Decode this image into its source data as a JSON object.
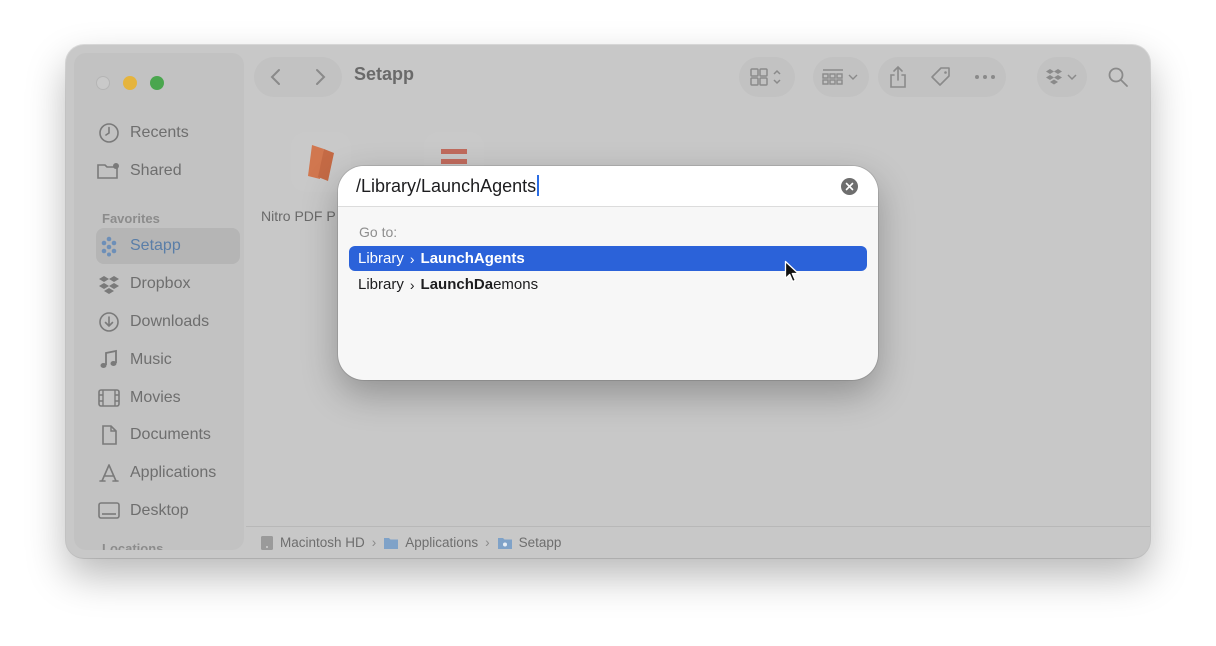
{
  "window": {
    "title": "Setapp"
  },
  "sidebar": {
    "items_top": [
      {
        "label": "Recents",
        "icon": "clock-icon"
      },
      {
        "label": "Shared",
        "icon": "shared-folder-icon"
      }
    ],
    "favorites_heading": "Favorites",
    "favorites": [
      {
        "label": "Setapp",
        "icon": "setapp-icon",
        "selected": true
      },
      {
        "label": "Dropbox",
        "icon": "dropbox-icon"
      },
      {
        "label": "Downloads",
        "icon": "download-icon"
      },
      {
        "label": "Music",
        "icon": "music-icon"
      },
      {
        "label": "Movies",
        "icon": "film-icon"
      },
      {
        "label": "Documents",
        "icon": "document-icon"
      },
      {
        "label": "Applications",
        "icon": "applications-icon"
      },
      {
        "label": "Desktop",
        "icon": "desktop-icon"
      }
    ],
    "locations_heading": "Locations"
  },
  "content": {
    "file_label": "Nitro PDF P"
  },
  "pathbar": {
    "segments": [
      "Macintosh HD",
      "Applications",
      "Setapp"
    ],
    "separator": "›"
  },
  "goto_dialog": {
    "input_value": "/Library/LaunchAgents",
    "goto_label": "Go to:",
    "results": [
      {
        "parent": "Library",
        "chevron": "›",
        "bold": "LaunchAgents",
        "rest_bold2": "",
        "rest": "",
        "selected": true
      },
      {
        "parent": "Library",
        "chevron": "›",
        "bold": "Launch",
        "rest_plain1": "",
        "rest_bold2": "Da",
        "rest": "emons",
        "selected": false
      }
    ]
  },
  "colors": {
    "selection": "#2b62d9",
    "traffic_min": "#e5b43d",
    "traffic_zoom": "#4aa64e"
  }
}
